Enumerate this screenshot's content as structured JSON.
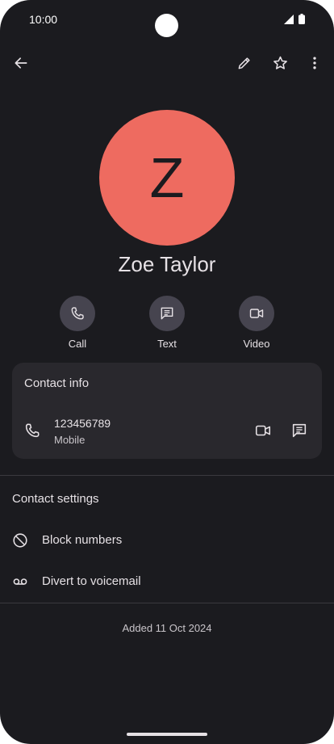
{
  "status_bar": {
    "time": "10:00"
  },
  "app_bar": {
    "back_icon": "arrow-left",
    "edit_icon": "pencil",
    "favorite_icon": "star-outline",
    "more_icon": "more-vert"
  },
  "contact": {
    "initial": "Z",
    "name": "Zoe Taylor",
    "avatar_color": "#ee6b60"
  },
  "actions": [
    {
      "label": "Call",
      "icon": "phone"
    },
    {
      "label": "Text",
      "icon": "message"
    },
    {
      "label": "Video",
      "icon": "videocam"
    }
  ],
  "contact_info": {
    "title": "Contact info",
    "number": "123456789",
    "type": "Mobile"
  },
  "contact_settings": {
    "title": "Contact settings",
    "items": [
      {
        "label": "Block numbers",
        "icon": "block"
      },
      {
        "label": "Divert to voicemail",
        "icon": "voicemail"
      }
    ]
  },
  "footer": {
    "added": "Added 11 Oct 2024"
  }
}
